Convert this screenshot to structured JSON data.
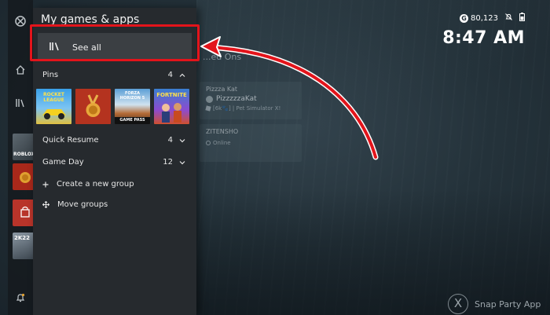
{
  "guide": {
    "title": "My games & apps",
    "see_all_label": "See all",
    "pins": {
      "label": "Pins",
      "count": "4"
    },
    "pinned_tiles": [
      {
        "name": "Rocket League",
        "caption": "ROCKET LEAGUE"
      },
      {
        "name": "Achievements"
      },
      {
        "name": "Forza Horizon 5",
        "caption": "FORZA HORIZON 5",
        "badge": "GAME PASS"
      },
      {
        "name": "Fortnite",
        "caption": "FORTNITE"
      }
    ],
    "quick_resume": {
      "label": "Quick Resume",
      "count": "4"
    },
    "game_day": {
      "label": "Game Day",
      "count": "12"
    },
    "create_group_label": "Create a new group",
    "move_groups_label": "Move groups"
  },
  "status": {
    "gamerscore": "80,123",
    "coin_letter": "G",
    "time": "8:47 AM"
  },
  "background": {
    "heading": "...ed Ons",
    "friends": [
      {
        "name": "Pizzza Kat",
        "gamertag": "PizzzzzaKat",
        "status": "[6k🐾] | Pet Simulator X!"
      },
      {
        "name": "ZITENSHO",
        "gamertag": "",
        "status": "Online"
      }
    ]
  },
  "rail": {
    "tile_labels": [
      "ROBLOX",
      "",
      "",
      "2K22"
    ]
  },
  "snap": {
    "button_letter": "X",
    "label": "Snap Party App"
  },
  "colors": {
    "highlight": "#e3141b",
    "panel": "#262a2e",
    "selected_row": "#3b3f43"
  }
}
